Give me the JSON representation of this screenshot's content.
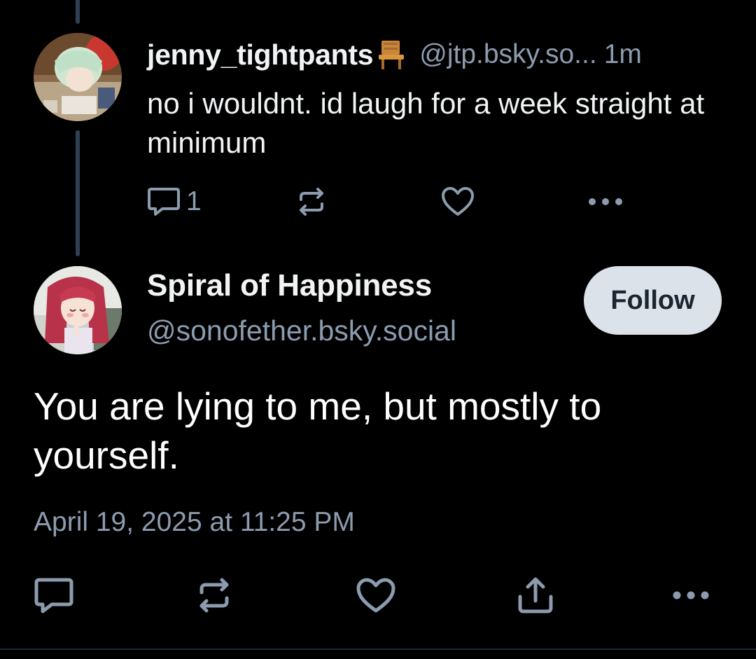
{
  "reply": {
    "author_name": "jenny_tightpants",
    "name_emoji": "chair-emoji",
    "handle": "@jtp.bsky.so...",
    "time": "1m",
    "text": "no i wouldnt. id laugh for a week straight at minimum",
    "reply_count": "1",
    "icons": [
      "reply-icon",
      "repost-icon",
      "like-icon",
      "more-icon"
    ]
  },
  "post": {
    "author_name": "Spiral of Happiness",
    "handle": "@sonofether.bsky.social",
    "follow_label": "Follow",
    "text": "You are lying to me, but mostly to yourself.",
    "timestamp": "April 19, 2025 at 11:25 PM",
    "icons": [
      "reply-icon",
      "repost-icon",
      "like-icon",
      "share-icon",
      "more-icon"
    ]
  },
  "colors": {
    "background": "#000000",
    "text_primary": "#f1f3f5",
    "text_secondary": "#8c9bae",
    "thread_line": "#2e4052",
    "follow_button_bg": "#dce2ea",
    "follow_button_text": "#1a2530"
  }
}
